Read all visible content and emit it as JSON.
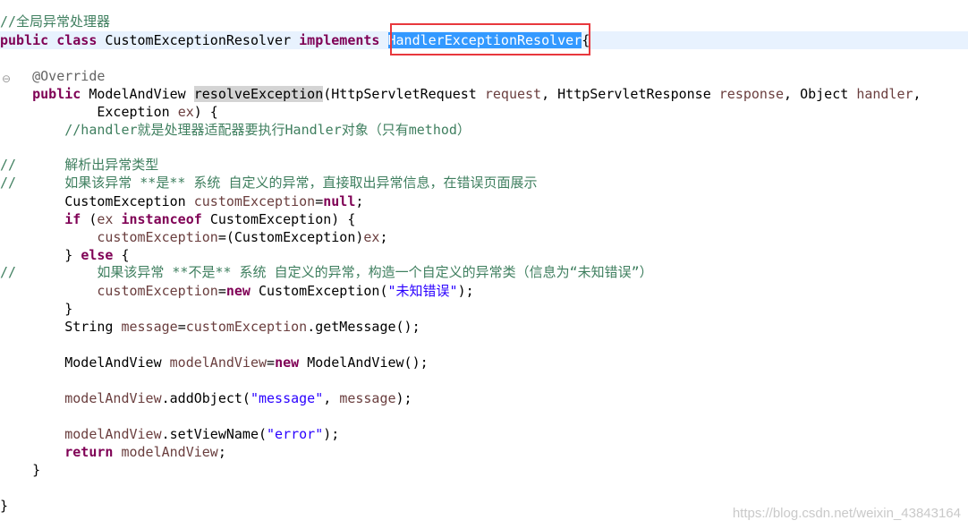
{
  "colors": {
    "keyword": "#7f0055",
    "comment": "#3f7f5f",
    "annotation": "#646464",
    "string": "#2a00ff",
    "variable": "#6a3e3e",
    "selection": "#3399ff",
    "occurrence": "#d4d4d4",
    "current_line": "#e8f2fe",
    "highlight_box": "#e8383d"
  },
  "fold_marker": "⊖",
  "watermark": "https://blog.csdn.net/weixin_43843164",
  "code": {
    "l1": {
      "comment": "//全局异常处理器"
    },
    "l2": {
      "kw1": "public",
      "kw2": "class",
      "cls": "CustomExceptionResolver",
      "kw3": "implements",
      "iface": "HandlerExceptionResolver",
      "brace": "{"
    },
    "l3": {
      "ann": "@Override"
    },
    "l4": {
      "kw": "public",
      "type": "ModelAndView",
      "method": "resolveException",
      "p1": "(HttpServletRequest",
      "v1": "request",
      "p2": ", HttpServletResponse",
      "v2": "response",
      "p3": ", Object",
      "v3": "handler",
      "p4": ","
    },
    "l5": {
      "p1": "Exception",
      "v1": "ex",
      "p2": ") {"
    },
    "l6": {
      "comment": "//handler就是处理器适配器要执行Handler对象（只有method）"
    },
    "l7": {
      "slashes": "//",
      "comment": "解析出异常类型"
    },
    "l8": {
      "slashes": "//",
      "comment": "如果该异常 **是** 系统 自定义的异常，直接取出异常信息，在错误页面展示"
    },
    "l9": {
      "type": "CustomException",
      "var": "customException",
      "eq": "=",
      "kw": "null",
      "end": ";"
    },
    "l10": {
      "kw1": "if",
      "p1": " (",
      "var": "ex",
      "kw2": "instanceof",
      "p2": "CustomException) {"
    },
    "l11": {
      "var1": "customException",
      "p1": "=(CustomException)",
      "var2": "ex",
      "end": ";"
    },
    "l12": {
      "p1": "}",
      "kw": "else",
      "p2": "{"
    },
    "l13": {
      "slashes": "//",
      "comment": "如果该异常 **不是** 系统 自定义的异常，构造一个自定义的异常类（信息为“未知错误”）"
    },
    "l14": {
      "var": "customException",
      "eq": "=",
      "kw": "new",
      "p1": "CustomException(",
      "str": "\"未知错误\"",
      "end": ");"
    },
    "l15": {
      "p1": "}"
    },
    "l16": {
      "type": "String",
      "var1": "message",
      "eq": "=",
      "var2": "customException",
      "p1": ".getMessage();"
    },
    "l17": {
      "type": "ModelAndView",
      "var": "modelAndView",
      "eq": "=",
      "kw": "new",
      "p1": "ModelAndView();"
    },
    "l18": {
      "var1": "modelAndView",
      "p1": ".addObject(",
      "str": "\"message\"",
      "p2": ", ",
      "var2": "message",
      "end": ");"
    },
    "l19": {
      "var": "modelAndView",
      "p1": ".setViewName(",
      "str": "\"error\"",
      "end": ");"
    },
    "l20": {
      "kw": "return",
      "var": "modelAndView",
      "end": ";"
    },
    "l21": {
      "p1": "}"
    },
    "l22": {
      "p1": "}"
    }
  }
}
